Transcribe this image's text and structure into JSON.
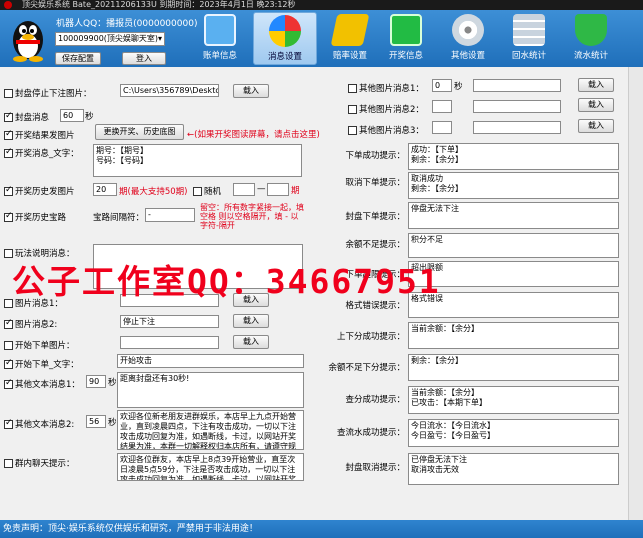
{
  "titlebar": {
    "text": "顶尖娱乐系统 Bate_20211206133U    到期时间：2023年4月1日 晚23:12秒"
  },
  "header": {
    "robot_qq_label": "机器人QQ：播报员(0000000000)",
    "group_select": "100009900(顶尖娱聊天室)",
    "save_config": "保存配置",
    "login": "登入",
    "nav": [
      {
        "label": "账单信息",
        "icon": "monitor-icon",
        "color": "#5ab0f0"
      },
      {
        "label": "消息设置",
        "icon": "windows-logo-icon",
        "color": "#f5f5f5"
      },
      {
        "label": "赔率设置",
        "icon": "lightning-icon",
        "color": "#f2c100"
      },
      {
        "label": "开奖信息",
        "icon": "chart-icon",
        "color": "#22bb44"
      },
      {
        "label": "其他设置",
        "icon": "disc-icon",
        "color": "#cfd8e0"
      },
      {
        "label": "回水统计",
        "icon": "table-icon",
        "color": "#c8d3de"
      },
      {
        "label": "流水统计",
        "icon": "shield-icon",
        "color": "#2fb846"
      }
    ]
  },
  "left": {
    "row1_label": "封盘停止下注图片：",
    "row1_path": "C:\\Users\\356789\\Desktop",
    "row1_btn": "载入",
    "row2_label": "封盘消息",
    "row2_value": "60",
    "row2_unit": "秒",
    "row3_label": "开奖结果发图片",
    "row3_btn": "更换开奖、历史底图",
    "row3_note": "←(如果开奖图读屏幕，请点击这里)",
    "row4_label": "开奖消息_文字：",
    "row4_text": "期号：【期号】\n号码：【号码】",
    "row5_label": "开奖历史发图片",
    "row5_value": "20",
    "row5_note": "期(最大支持50期)",
    "row5_random": "随机",
    "row5_dash": "—",
    "row5_unit": "期",
    "row6_label": "开奖历史宝路",
    "row6_sep_label": "宝路间隔符：",
    "row6_sep_value": "-",
    "row6_hint": "留空：所有数字紧接一起，填 空格 则以空格隔开，填 - 以字符-隔开",
    "row7_label": "玩法说明消息：",
    "img1_label": "图片消息1：",
    "img1_btn": "载入",
    "img2_label": "图片消息2:",
    "img2_value": "停止下注",
    "img2_btn": "载入",
    "bet_img_label": "开始下单图片：",
    "bet_img_btn": "载入",
    "bet_text_label": "开始下单_文字：",
    "bet_text_value": "开始攻击",
    "other1_label": "其他文本消息1：",
    "other1_value": "90",
    "other1_unit": "秒",
    "other1_text": "距离封盘还有30秒!",
    "other2_label": "其他文本消息2:",
    "other2_value": "56",
    "other2_unit": "秒",
    "other2_text": "欢迎各位新老朋友进群娱乐，本店早上九点开始营业，直到凌晨四点，下注有攻击成功，一切以下注攻击成功回复为准，如遇断线，卡过，以网站开奖结果为准，本群一切解释权归本店所有，请遵守规则娱乐。",
    "group_chat_label": "群内聊天提示：",
    "group_chat_text": "欢迎各位群友，本店早上8点39开始营业，直至次日凌晨5点59分，下注是否攻击成功，一切以下注攻击成功回复为准。如遇断线，卡过，以网站开奖结果为准。"
  },
  "watermark": "公子工作室QQ：34667951",
  "right": {
    "other_img1": "其他图片消息1：",
    "other_img1_value": "0",
    "other_img1_unit": "秒",
    "other_img1_btn": "载入",
    "other_img2": "其他图片消息2：",
    "other_img2_btn": "载入",
    "other_img3": "其他图片消息3：",
    "other_img3_btn": "载入",
    "rows": [
      {
        "label": "下单成功提示：",
        "text": "成功：【下单】\n剩余：【余分】"
      },
      {
        "label": "取消下单提示：",
        "text": "取消成功\n剩余：【余分】"
      },
      {
        "label": "封盘下单提示：",
        "text": "停盘无法下注"
      },
      {
        "label": "余额不足提示：",
        "text": "积分不足"
      },
      {
        "label": "下单超限提示：",
        "text": "超出限额"
      },
      {
        "label": "格式错误提示：",
        "text": "格式错误"
      },
      {
        "label": "上下分成功提示：",
        "text": "当前余额：【余分】"
      },
      {
        "label": "余额不足下分提示：",
        "text": "剩余：【余分】"
      },
      {
        "label": "查分成功提示：",
        "text": "当前余额：【余分】\n已攻击：【本期下单】"
      },
      {
        "label": "查流水成功提示：",
        "text": "今日流水：【今日流水】\n今日盈亏：【今日盈亏】"
      },
      {
        "label": "封盘取消提示：",
        "text": "已停盘无法下注\n取消攻击无效"
      }
    ]
  },
  "footer": {
    "text": "免责声明：顶尖·娱乐系统仅供娱乐和研究，严禁用于非法用途！"
  }
}
